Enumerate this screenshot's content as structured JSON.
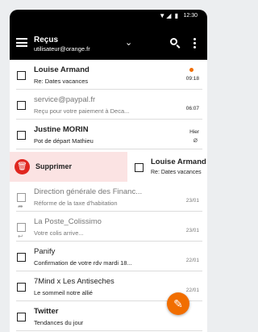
{
  "status_bar": {
    "time": "12:30",
    "signal": "▼◢ ▮"
  },
  "toolbar": {
    "folder": "Reçus",
    "account": "utilisateur@orange.fr"
  },
  "swipe_action": {
    "label": "Supprimer"
  },
  "messages": [
    {
      "sender": "Louise Armand",
      "subject": "Re: Dates vacances",
      "date": "09:18",
      "unread": true
    },
    {
      "sender": "service@paypal.fr",
      "subject": "Reçu pour votre paiement à Deca...",
      "date": "06:07",
      "unread": false
    },
    {
      "sender": "Justine MORIN",
      "subject": "Pot de départ Mathieu",
      "date": "Hier",
      "unread": false,
      "attachment": true
    },
    {
      "sender": "Louise Armand",
      "subject": "Re: Dates vacances",
      "date": "",
      "unread": false
    },
    {
      "sender": "Direction générale des Financ...",
      "subject": "Réforme de la taxe d'habitation",
      "date": "23/01",
      "unread": false
    },
    {
      "sender": "La Poste_Colissimo",
      "subject": "Votre colis arrive...",
      "date": "23/01",
      "unread": false
    },
    {
      "sender": "Panify",
      "subject": "Confirmation de votre rdv mardi 18...",
      "date": "22/01",
      "unread": false
    },
    {
      "sender": "7Mind x Les Antiseches",
      "subject": "Le sommeil notre allié",
      "date": "22/01",
      "unread": false
    },
    {
      "sender": "Twitter",
      "subject": "Tendances du jour",
      "date": "",
      "unread": false
    }
  ],
  "colors": {
    "accent": "#f16e00",
    "delete": "#e0261f",
    "delete_bg": "#fbe3e3"
  },
  "icons": [
    "menu-icon",
    "chevron-down-icon",
    "search-icon",
    "more-vertical-icon",
    "trash-icon",
    "paperclip-icon",
    "forward-icon",
    "reply-icon",
    "pencil-icon"
  ]
}
